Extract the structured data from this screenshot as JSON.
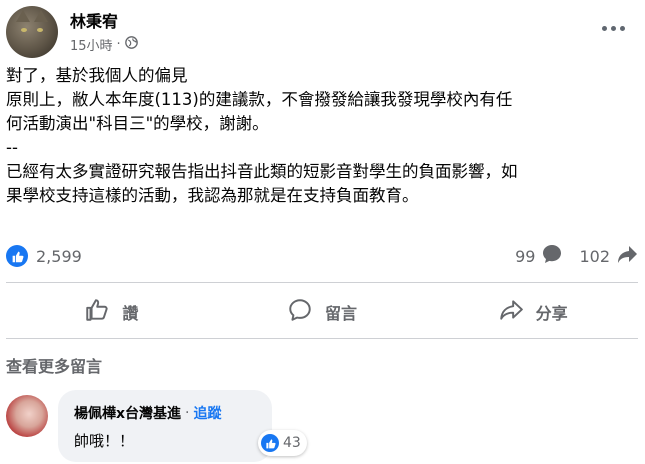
{
  "post": {
    "author": "林秉宥",
    "time": "15小時",
    "dot": "·",
    "text": "對了，基於我個人的偏見\n原則上，敝人本年度(113)的建議款，不會撥發給讓我發現學校內有任\n何活動演出\"科目三\"的學校，謝謝。\n--\n已經有太多實證研究報告指出抖音此類的短影音對學生的負面影響，如\n果學校支持這樣的活動，我認為那就是在支持負面教育。"
  },
  "stats": {
    "reactions": "2,599",
    "comments": "99",
    "shares": "102"
  },
  "actions": {
    "like": "讚",
    "comment": "留言",
    "share": "分享"
  },
  "comments_section": {
    "view_more": "查看更多留言",
    "items": [
      {
        "name": "楊佩樺x台灣基進",
        "dot": "·",
        "follow": "追蹤",
        "text": "帥哦！！",
        "likes": "43"
      }
    ]
  },
  "colors": {
    "accent": "#1877f2",
    "secondary_text": "#65676b",
    "bubble": "#f0f2f5"
  }
}
